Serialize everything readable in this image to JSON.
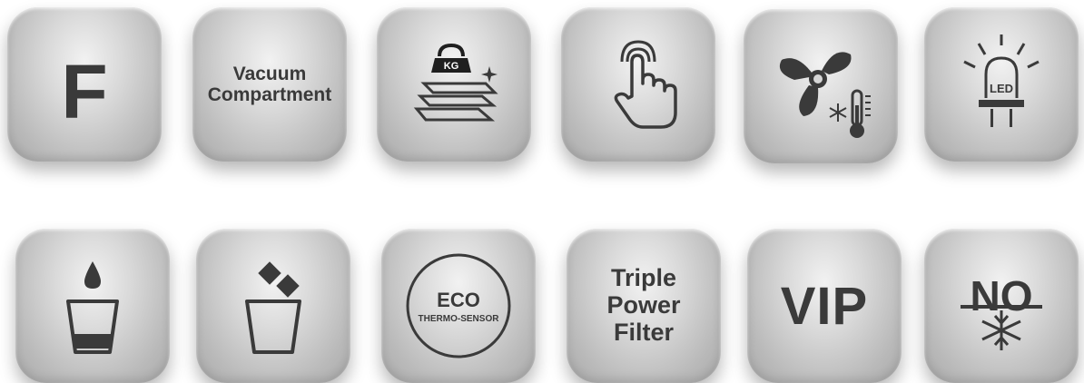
{
  "tiles": {
    "f": {
      "label": "F"
    },
    "vacuum": {
      "line1": "Vacuum",
      "line2": "Compartment"
    },
    "weight": {
      "badge": "KG",
      "icon": "weight-shelf-icon"
    },
    "touch": {
      "icon": "touch-hand-icon"
    },
    "fan": {
      "icon": "fan-thermometer-icon"
    },
    "led": {
      "label": "LED",
      "icon": "led-bulb-icon"
    },
    "water": {
      "icon": "water-cup-icon"
    },
    "ice": {
      "icon": "ice-bucket-icon"
    },
    "eco": {
      "line1": "ECO",
      "line2": "THERMO-SENSOR"
    },
    "triple": {
      "line1": "Triple",
      "line2": "Power",
      "line3": "Filter"
    },
    "vip": {
      "label": "VIP"
    },
    "nofrost": {
      "label": "NO",
      "icon": "no-frost-icon"
    }
  },
  "colors": {
    "icon": "#3a3a3a",
    "tile_light": "#f2f2f2",
    "tile_dark": "#a9a9a9"
  }
}
